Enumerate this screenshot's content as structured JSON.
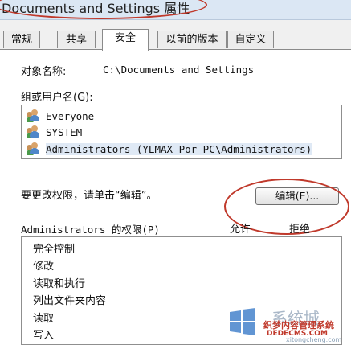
{
  "window": {
    "title": "Documents and Settings 属性"
  },
  "tabs": [
    {
      "label": "常规"
    },
    {
      "label": "共享"
    },
    {
      "label": "安全"
    },
    {
      "label": "以前的版本"
    },
    {
      "label": "自定义"
    }
  ],
  "object": {
    "label": "对象名称:",
    "value": "C:\\Documents and Settings"
  },
  "groups": {
    "label": "组或用户名(G):",
    "items": [
      {
        "name": "Everyone"
      },
      {
        "name": "SYSTEM"
      },
      {
        "name": "Administrators (YLMAX-Por-PC\\Administrators)"
      }
    ]
  },
  "change_hint": "要更改权限，请单击“编辑”。",
  "edit_button": "编辑(E)...",
  "permissions": {
    "label": "Administrators 的权限(P)",
    "allow_header": "允许",
    "deny_header": "拒绝",
    "items": [
      "完全控制",
      "修改",
      "读取和执行",
      "列出文件夹内容",
      "读取",
      "写入"
    ]
  },
  "watermark": {
    "brand": "系统城",
    "line1": "织梦内容管理系统",
    "line2": "DEDECMS.COM",
    "url": "xitongcheng.com"
  },
  "annotation_color": "#c0392b"
}
